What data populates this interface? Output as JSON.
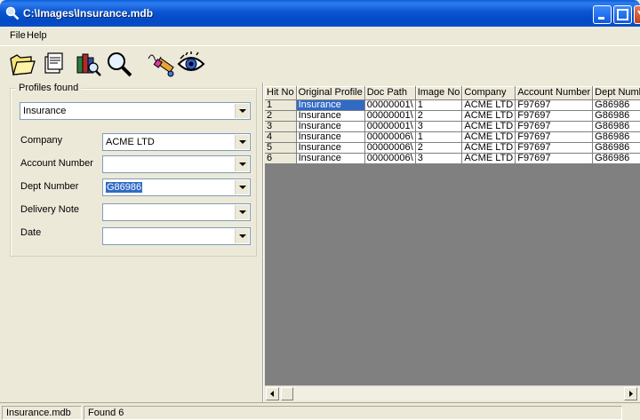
{
  "window": {
    "title": "C:\\Images\\Insurance.mdb"
  },
  "menu": {
    "file": "File",
    "help": "Help"
  },
  "toolbar": [
    "open-folder-icon",
    "properties-icon",
    "library-search-icon",
    "magnify-icon",
    "signature-pen-icon",
    "eye-view-icon"
  ],
  "profiles": {
    "group_title": "Profiles found",
    "profile_value": "Insurance",
    "company_label": "Company",
    "company_value": "ACME LTD",
    "account_label": "Account Number",
    "account_value": "",
    "dept_label": "Dept Number",
    "dept_value": "G86986",
    "delivery_label": "Delivery Note",
    "delivery_value": "",
    "date_label": "Date",
    "date_value": ""
  },
  "grid": {
    "headers": [
      "Hit No",
      "Original Profile",
      "Doc Path",
      "Image No",
      "Company",
      "Account Number",
      "Dept Number"
    ],
    "rows": [
      [
        "1",
        "Insurance",
        "00000001\\",
        "1",
        "ACME LTD",
        "F97697",
        "G86986"
      ],
      [
        "2",
        "Insurance",
        "00000001\\",
        "2",
        "ACME LTD",
        "F97697",
        "G86986"
      ],
      [
        "3",
        "Insurance",
        "00000001\\",
        "3",
        "ACME LTD",
        "F97697",
        "G86986"
      ],
      [
        "4",
        "Insurance",
        "00000006\\",
        "1",
        "ACME LTD",
        "F97697",
        "G86986"
      ],
      [
        "5",
        "Insurance",
        "00000006\\",
        "2",
        "ACME LTD",
        "F97697",
        "G86986"
      ],
      [
        "6",
        "Insurance",
        "00000006\\",
        "3",
        "ACME LTD",
        "F97697",
        "G86986"
      ]
    ]
  },
  "status": {
    "file": "Insurance.mdb",
    "found": "Found 6"
  },
  "colors": {
    "titlebar": "#0a55d0",
    "selection": "#316ac5",
    "grid_background": "#808080"
  }
}
